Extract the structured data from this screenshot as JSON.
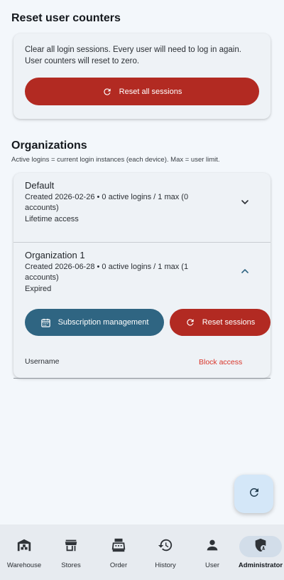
{
  "reset_section": {
    "title": "Reset user counters",
    "description": "Clear all login sessions. Every user will need to log in again. User counters will reset to zero.",
    "button_label": "Reset all sessions"
  },
  "organizations": {
    "title": "Organizations",
    "subtitle": "Active logins = current login instances (each device). Max = user limit.",
    "items": [
      {
        "name": "Default",
        "details": "Created 2026-02-26 • 0 active logins / 1 max (0 accounts)",
        "status": "Lifetime access",
        "expanded": false
      },
      {
        "name": "Organization 1",
        "details": "Created 2026-06-28 • 0 active logins / 1 max (1 accounts)",
        "status": "Expired",
        "expanded": true,
        "subscription_button": "Subscription management",
        "reset_button": "Reset sessions",
        "username_label": "Username",
        "block_label": "Block access"
      }
    ]
  },
  "nav": {
    "items": [
      {
        "label": "Warehouse",
        "icon": "warehouse-icon"
      },
      {
        "label": "Stores",
        "icon": "store-icon"
      },
      {
        "label": "Order",
        "icon": "cash-register-icon"
      },
      {
        "label": "History",
        "icon": "history-icon"
      },
      {
        "label": "User",
        "icon": "person-icon"
      },
      {
        "label": "Administrator",
        "icon": "admin-shield-icon",
        "active": true
      }
    ]
  },
  "colors": {
    "primary_red": "#b22a22",
    "primary_blue": "#2f6582",
    "link_red": "#d9362b",
    "background": "#f3f7fb",
    "fab": "#d4e7f8"
  }
}
